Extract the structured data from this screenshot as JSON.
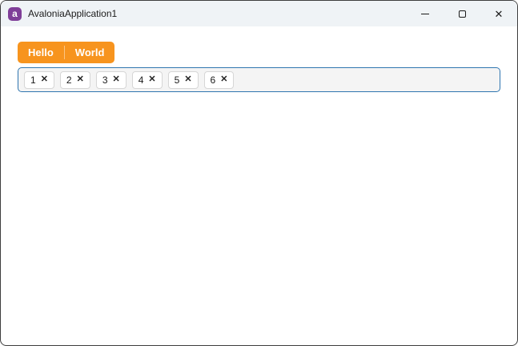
{
  "window": {
    "title": "AvaloniaApplication1",
    "app_icon_glyph": "a",
    "controls": {
      "close_glyph": "✕"
    }
  },
  "tabstrip": {
    "background_color": "#F7941E",
    "tabs": [
      {
        "label": "Hello"
      },
      {
        "label": "World"
      }
    ]
  },
  "chips": {
    "border_color": "#2f76b0",
    "close_glyph": "✕",
    "items": [
      {
        "label": "1"
      },
      {
        "label": "2"
      },
      {
        "label": "3"
      },
      {
        "label": "4"
      },
      {
        "label": "5"
      },
      {
        "label": "6"
      }
    ]
  }
}
